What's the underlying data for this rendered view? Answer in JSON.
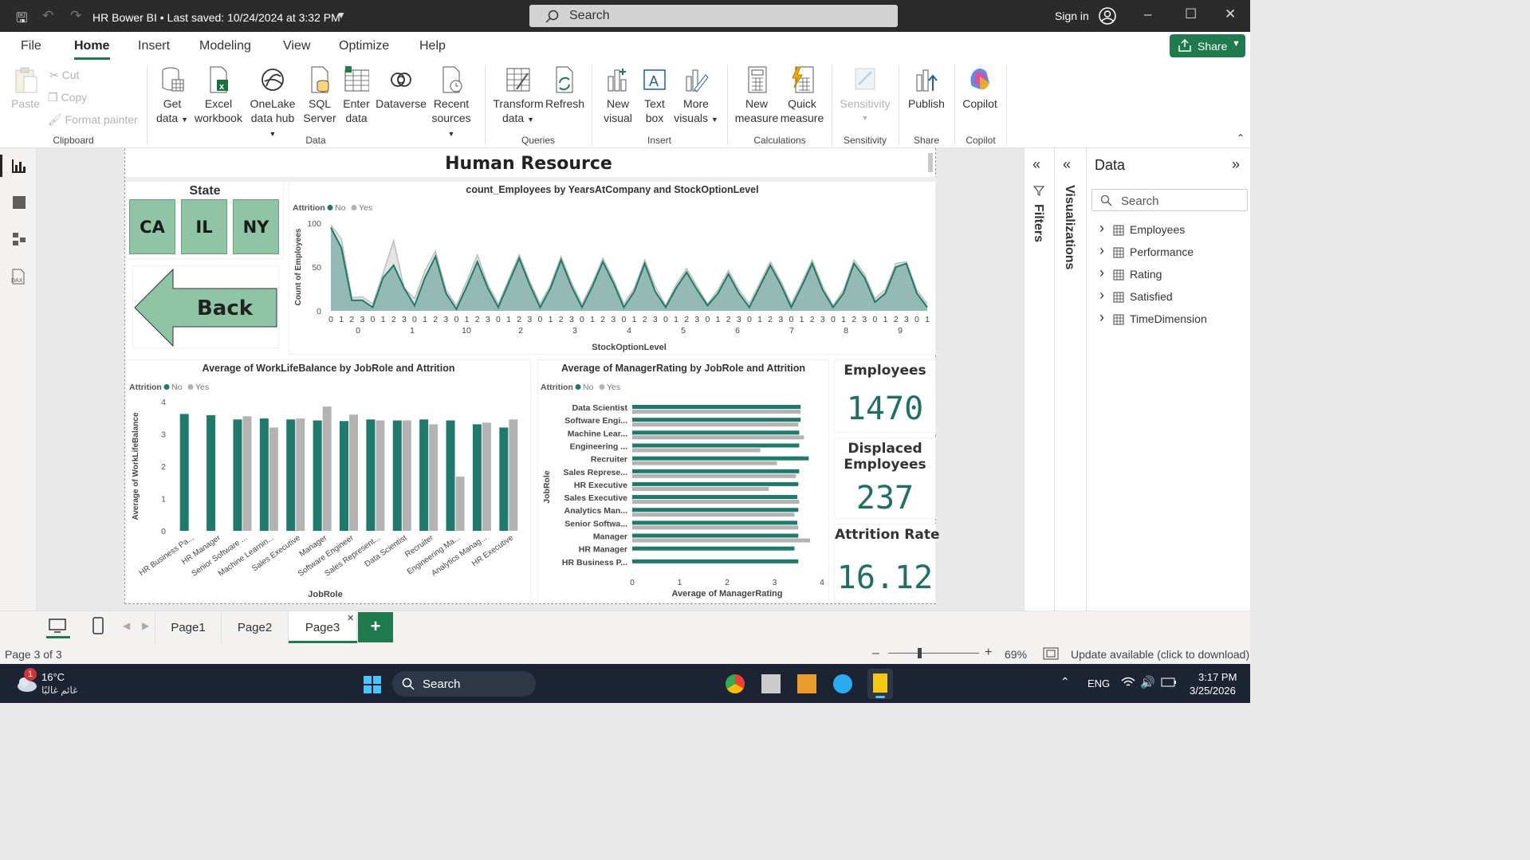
{
  "titlebar": {
    "title": "HR Bower BI • Last saved: 10/24/2024 at 3:32 PM",
    "search": "Search",
    "signin": "Sign in"
  },
  "menu": {
    "items": [
      "File",
      "Home",
      "Insert",
      "Modeling",
      "View",
      "Optimize",
      "Help"
    ],
    "active": "Home",
    "share": "Share"
  },
  "ribbon": {
    "paste": "Paste",
    "cut": "Cut",
    "copy": "Copy",
    "format_painter": "Format painter",
    "clipboard": "Clipboard",
    "get_data": [
      "Get",
      "data"
    ],
    "excel": [
      "Excel",
      "workbook"
    ],
    "onelake": [
      "OneLake",
      "data hub"
    ],
    "sql": [
      "SQL",
      "Server"
    ],
    "enter": [
      "Enter",
      "data"
    ],
    "dataverse": "Dataverse",
    "recent": [
      "Recent",
      "sources"
    ],
    "data_group": "Data",
    "transform": [
      "Transform",
      "data"
    ],
    "refresh": "Refresh",
    "queries_group": "Queries",
    "new_visual": [
      "New",
      "visual"
    ],
    "text_box": [
      "Text",
      "box"
    ],
    "more_visuals": [
      "More",
      "visuals"
    ],
    "insert_group": "Insert",
    "new_measure": [
      "New",
      "measure"
    ],
    "quick_measure": [
      "Quick",
      "measure"
    ],
    "calc_group": "Calculations",
    "sensitivity": "Sensitivity",
    "sensitivity_group": "Sensitivity",
    "publish": "Publish",
    "share_group": "Share",
    "copilot": "Copilot",
    "copilot_group": "Copilot"
  },
  "report": {
    "title": "Human Resource",
    "state_slicer": {
      "title": "State",
      "options": [
        "CA",
        "IL",
        "NY"
      ]
    },
    "back_button": "Back",
    "kpis": [
      {
        "label": "Employees",
        "value": "1470"
      },
      {
        "label": "Displaced Employees",
        "value": "237"
      },
      {
        "label": "Attrition Rate",
        "value": "16.12"
      }
    ]
  },
  "chart_data": [
    {
      "type": "area",
      "title": "count_Employees by YearsAtCompany and StockOptionLevel",
      "legend_title": "Attrition",
      "legend": [
        "No",
        "Yes"
      ],
      "xlabel": "StockOptionLevel",
      "ylabel": "Count of Employees",
      "ylim": [
        0,
        100
      ],
      "yticks": [
        0,
        50,
        100
      ],
      "x_inner": [
        "0",
        "1",
        "2",
        "3"
      ],
      "x_groups": [
        "0",
        "1",
        "10",
        "2",
        "3",
        "4",
        "5",
        "6",
        "7",
        "8",
        "9"
      ],
      "series": [
        {
          "name": "No",
          "values": [
            95,
            72,
            12,
            12,
            4,
            38,
            52,
            26,
            6,
            38,
            62,
            20,
            2,
            28,
            56,
            26,
            4,
            32,
            60,
            30,
            4,
            26,
            58,
            28,
            4,
            28,
            56,
            32,
            4,
            22,
            54,
            22,
            4,
            26,
            44,
            24,
            6,
            20,
            42,
            20,
            4,
            28,
            52,
            30,
            4,
            28,
            54,
            24,
            4,
            20,
            54,
            38,
            10,
            20,
            50,
            54,
            20,
            4
          ]
        },
        {
          "name": "Yes",
          "values": [
            98,
            82,
            15,
            16,
            8,
            43,
            80,
            26,
            14,
            46,
            68,
            24,
            6,
            34,
            64,
            30,
            8,
            36,
            64,
            34,
            8,
            30,
            62,
            32,
            8,
            32,
            60,
            36,
            8,
            26,
            58,
            28,
            6,
            30,
            48,
            28,
            8,
            24,
            46,
            24,
            8,
            32,
            56,
            34,
            8,
            32,
            58,
            28,
            6,
            24,
            58,
            42,
            14,
            24,
            54,
            56,
            24,
            8
          ]
        }
      ]
    },
    {
      "type": "bar",
      "title": "Average of WorkLifeBalance by JobRole and Attrition",
      "legend_title": "Attrition",
      "legend": [
        "No",
        "Yes"
      ],
      "xlabel": "JobRole",
      "ylabel": "Average of WorkLifeBalance",
      "ylim": [
        0,
        4
      ],
      "yticks": [
        0,
        1,
        2,
        3,
        4
      ],
      "categories": [
        "HR Business Pa...",
        "HR Manager",
        "Senior Software ...",
        "Machine Learnin...",
        "Sales Executive",
        "Manager",
        "Software Engineer",
        "Sales Represent...",
        "Data Scientist",
        "Recruiter",
        "Engineering Ma...",
        "Analytics Manag...",
        "HR Executive"
      ],
      "series": [
        {
          "name": "No",
          "values": [
            3.62,
            3.58,
            3.45,
            3.48,
            3.45,
            3.42,
            3.4,
            3.45,
            3.42,
            3.45,
            3.42,
            3.3,
            3.2
          ]
        },
        {
          "name": "Yes",
          "values": [
            null,
            null,
            3.55,
            3.2,
            3.48,
            3.85,
            3.6,
            3.42,
            3.42,
            3.3,
            1.68,
            3.35,
            3.45
          ]
        }
      ]
    },
    {
      "type": "bar",
      "orientation": "horizontal",
      "title": "Average of ManagerRating by JobRole and Attrition",
      "legend_title": "Attrition",
      "legend": [
        "No",
        "Yes"
      ],
      "xlabel": "Average of ManagerRating",
      "ylabel": "JobRole",
      "xlim": [
        0,
        4
      ],
      "xticks": [
        0,
        1,
        2,
        3,
        4
      ],
      "categories": [
        "Data Scientist",
        "Software Engi...",
        "Machine Lear...",
        "Engineering ...",
        "Recruiter",
        "Sales Represe...",
        "HR Executive",
        "Sales Executive",
        "Analytics Man...",
        "Senior Softwa...",
        "Manager",
        "HR Manager",
        "HR Business P..."
      ],
      "series": [
        {
          "name": "No",
          "values": [
            3.55,
            3.55,
            3.52,
            3.52,
            3.72,
            3.52,
            3.5,
            3.48,
            3.5,
            3.48,
            3.5,
            3.42,
            3.5
          ]
        },
        {
          "name": "Yes",
          "values": [
            3.55,
            3.5,
            3.62,
            2.7,
            3.05,
            3.45,
            2.88,
            3.52,
            3.42,
            3.5,
            3.75,
            null,
            null
          ]
        }
      ]
    }
  ],
  "panes": {
    "filters": "Filters",
    "visualizations": "Visualizations",
    "data_title": "Data",
    "data_search": "Search",
    "tables": [
      "Employees",
      "Performance",
      "Rating",
      "Satisfied",
      "TimeDimension"
    ]
  },
  "tabs": {
    "pages": [
      "Page1",
      "Page2",
      "Page3"
    ],
    "active": "Page3",
    "add": "+"
  },
  "status": {
    "page": "Page 3 of 3",
    "zoom": "69%",
    "update": "Update available (click to download)"
  },
  "taskbar": {
    "temp": "16°C",
    "weather": "غائم غالبًا",
    "search": "Search",
    "lang": "ENG",
    "time": "3:17 PM",
    "date": "3/25/2026",
    "badge": "1"
  },
  "colors": {
    "no": "#1f7a6c",
    "yes": "#b3b3b3",
    "slicer": "#8fc5a4",
    "accent": "#1f7a4d"
  }
}
